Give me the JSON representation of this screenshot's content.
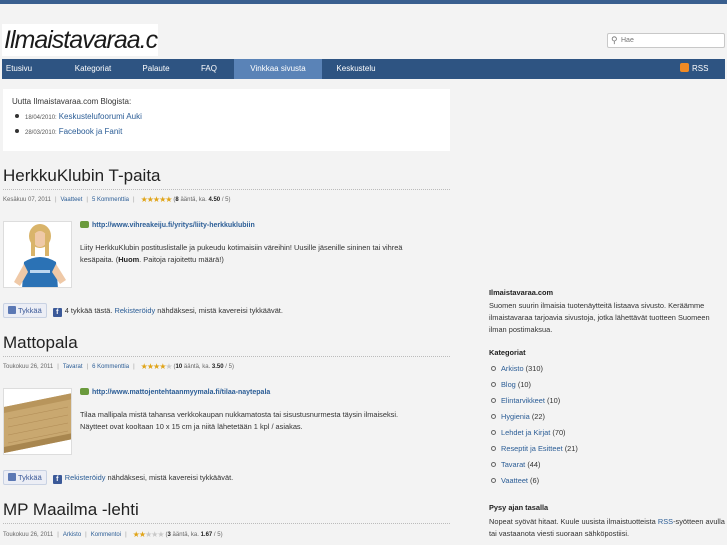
{
  "header": {
    "logo_text": "Ilmaistavaraa.com",
    "search_placeholder": "Hae"
  },
  "nav": {
    "items": [
      {
        "label": "Etusivu"
      },
      {
        "label": "Kategoriat"
      },
      {
        "label": "Palaute"
      },
      {
        "label": "FAQ"
      },
      {
        "label": "Vinkkaa sivusta"
      },
      {
        "label": "Keskustelu"
      }
    ],
    "rss_label": "RSS"
  },
  "blog": {
    "heading": "Uutta Ilmaistavaraa.com Blogista:",
    "items": [
      {
        "date": "18/04/2010:",
        "title": "Keskustelufoorumi Auki"
      },
      {
        "date": "28/03/2010:",
        "title": "Facebook ja Fanit"
      }
    ]
  },
  "posts": [
    {
      "title": "HerkkuKlubin T-paita",
      "date": "Kesäkuu 07, 2011",
      "category": "Vaatteet",
      "comments": "5 Kommenttia",
      "rating_stars": 4.5,
      "votes": "8",
      "votes_suffix": "ääntä, ka.",
      "avg": "4.50",
      "avg_suffix": "/ 5)",
      "url": "http://www.vihreakeiju.fi/yritys/liity-herkkuklubiin",
      "desc_1": "Liity HerkkuKlubin postituslistalle ja pukeudu kotimaisiin väreihin! Uusille jäsenille sininen tai vihreä kesäpaita. (",
      "desc_bold": "Huom",
      "desc_2": ". Paitoja rajoitettu määrä!)",
      "like_label": "Tykkää",
      "fb_count_text": "4 tykkää tästä.",
      "fb_register": "Rekisteröidy",
      "fb_rest": "nähdäksesi, mistä kavereisi tykkäävät."
    },
    {
      "title": "Mattopala",
      "date": "Toukokuu 26, 2011",
      "category": "Tavarat",
      "comments": "6 Kommenttia",
      "rating_stars": 3.5,
      "votes": "10",
      "votes_suffix": "ääntä, ka.",
      "avg": "3.50",
      "avg_suffix": "/ 5)",
      "url": "http://www.mattojentehtaanmyymala.fi/tilaa-naytepala",
      "desc_1": "Tilaa mallipala mistä tahansa verkkokaupan nukkamatosta tai sisustusnurmesta täysin ilmaiseksi. Näytteet ovat kooltaan 10 x 15 cm ja niitä lähetetään 1 kpl / asiakas.",
      "like_label": "Tykkää",
      "fb_register": "Rekisteröidy",
      "fb_rest": "nähdäksesi, mistä kavereisi tykkäävät."
    },
    {
      "title": "MP Maailma -lehti",
      "date": "Toukokuu 26, 2011",
      "category": "Arkisto",
      "comments": "Kommentoi",
      "rating_stars": 1.67,
      "votes": "3",
      "votes_suffix": "ääntä, ka.",
      "avg": "1.67",
      "avg_suffix": "/ 5)"
    }
  ],
  "sidebar": {
    "about_title": "Ilmaistavaraa.com",
    "about_text": "Suomen suurin ilmaisia tuotenäytteitä listaava sivusto. Keräämme ilmaistavaraa tarjoavia sivustoja, jotka lähettävät tuotteen Suomeen ilman postimaksua.",
    "categories_title": "Kategoriat",
    "categories": [
      {
        "name": "Arkisto",
        "count": "(310)"
      },
      {
        "name": "Blog",
        "count": "(10)"
      },
      {
        "name": "Elintarvikkeet",
        "count": "(10)"
      },
      {
        "name": "Hygienia",
        "count": "(22)"
      },
      {
        "name": "Lehdet ja Kirjat",
        "count": "(70)"
      },
      {
        "name": "Reseptit ja Esitteet",
        "count": "(21)"
      },
      {
        "name": "Tavarat",
        "count": "(44)"
      },
      {
        "name": "Vaatteet",
        "count": "(6)"
      }
    ],
    "stay_title": "Pysy ajan tasalla",
    "stay_text_1": "Nopeat syövät hitaat. Kuule uusista ilmaistuotteista",
    "stay_link": "RSS",
    "stay_text_2": "-syötteen avulla tai vastaanota viesti suoraan sähköpostiisi."
  },
  "colors": {
    "nav_bg": "#2e5482",
    "nav_active": "#5a83b7",
    "link": "#2b5d96",
    "star": "#e0a418"
  }
}
